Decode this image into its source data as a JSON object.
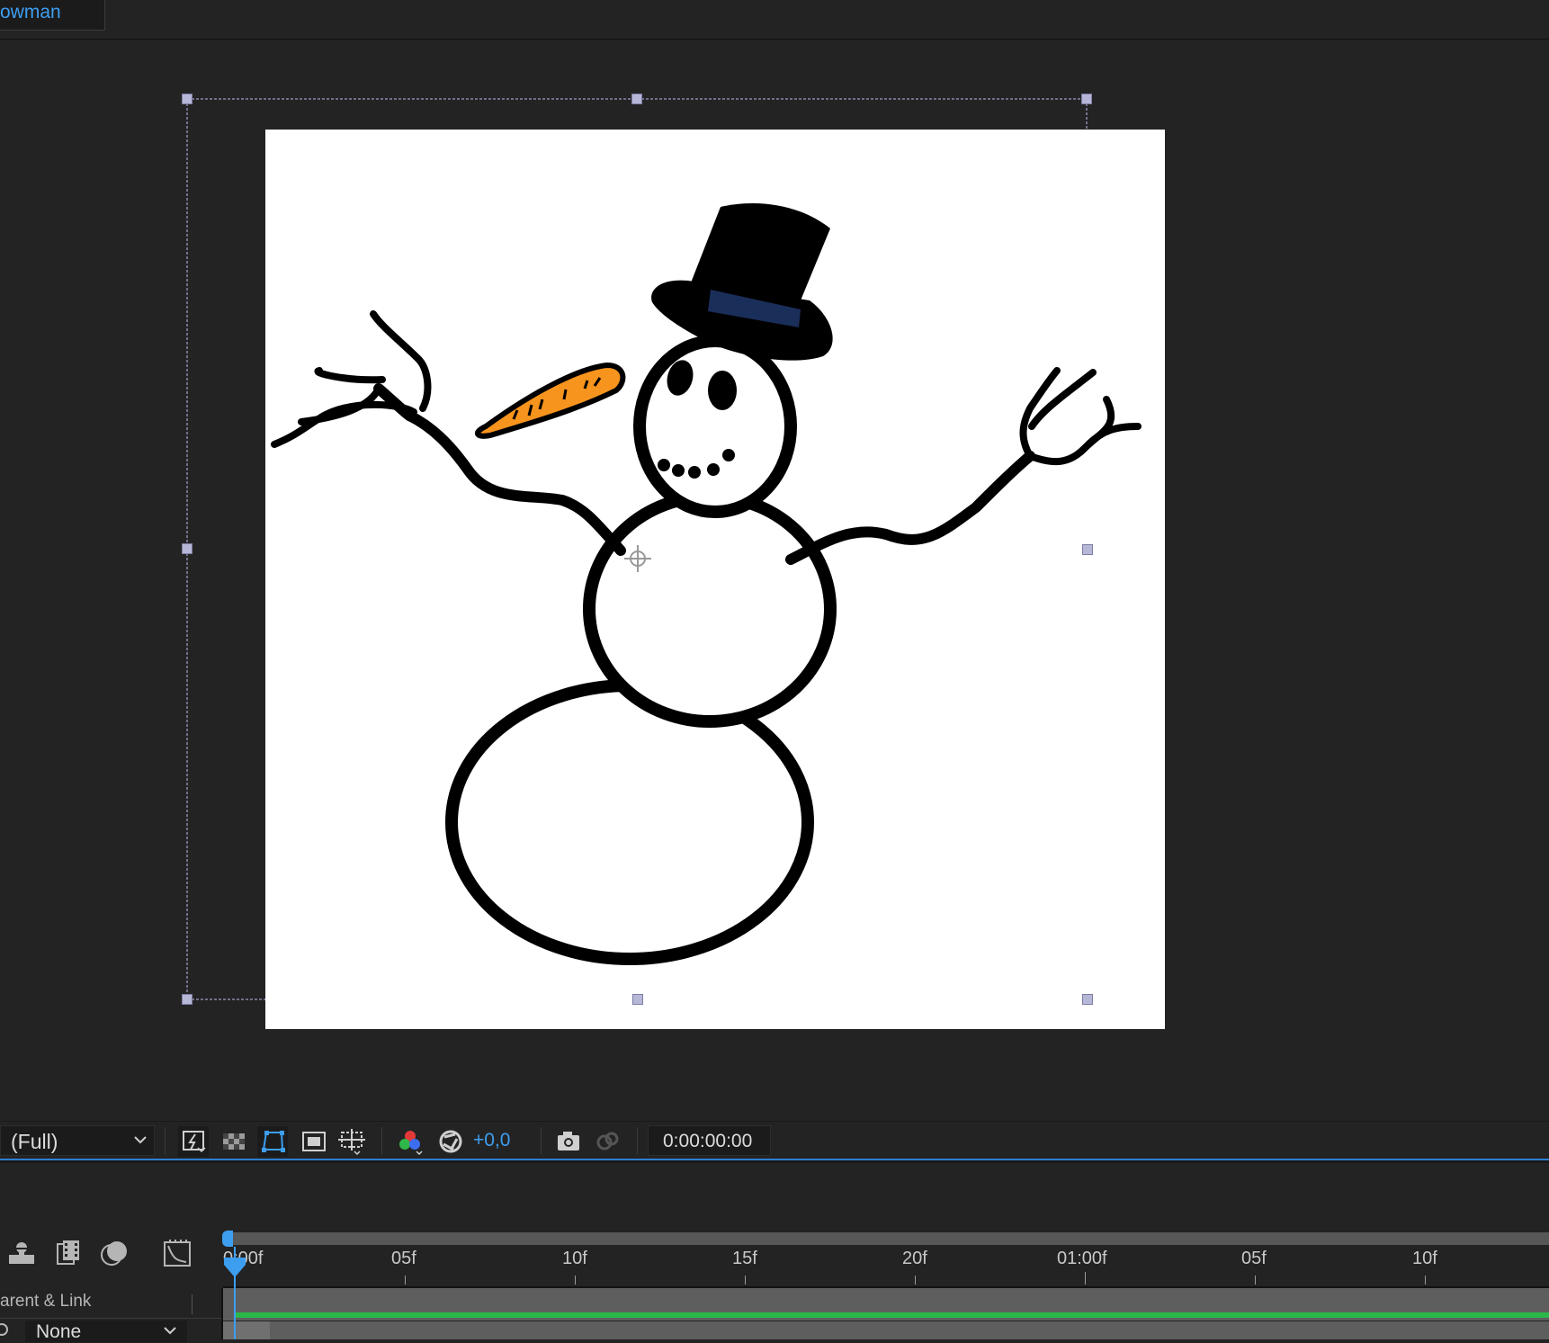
{
  "tab": {
    "label": "owman"
  },
  "viewer_toolbar": {
    "resolution": "(Full)",
    "exposure": "+0,0",
    "timecode": "0:00:00:00"
  },
  "timeline": {
    "ruler_labels": [
      "0:00f",
      "05f",
      "10f",
      "15f",
      "20f",
      "01:00f",
      "05f",
      "10f"
    ],
    "parent_link_header": "arent & Link",
    "parent_value": "None"
  },
  "colors": {
    "accent": "#3d9ef0",
    "layer_bar": "#2bb84a",
    "panel_bg": "#232323",
    "carrot": "#f7941d",
    "hat_band": "#1a2e5a"
  },
  "icons": {
    "toolbar": [
      "fast-previews-icon",
      "transparency-grid-icon",
      "mask-path-visibility-icon",
      "region-of-interest-icon",
      "guides-grid-icon",
      "color-channel-icon",
      "exposure-reset-icon",
      "snapshot-camera-icon",
      "show-snapshot-icon"
    ],
    "timeline": [
      "shy-layers-icon",
      "frame-blending-icon",
      "motion-blur-icon",
      "graph-editor-icon"
    ]
  }
}
